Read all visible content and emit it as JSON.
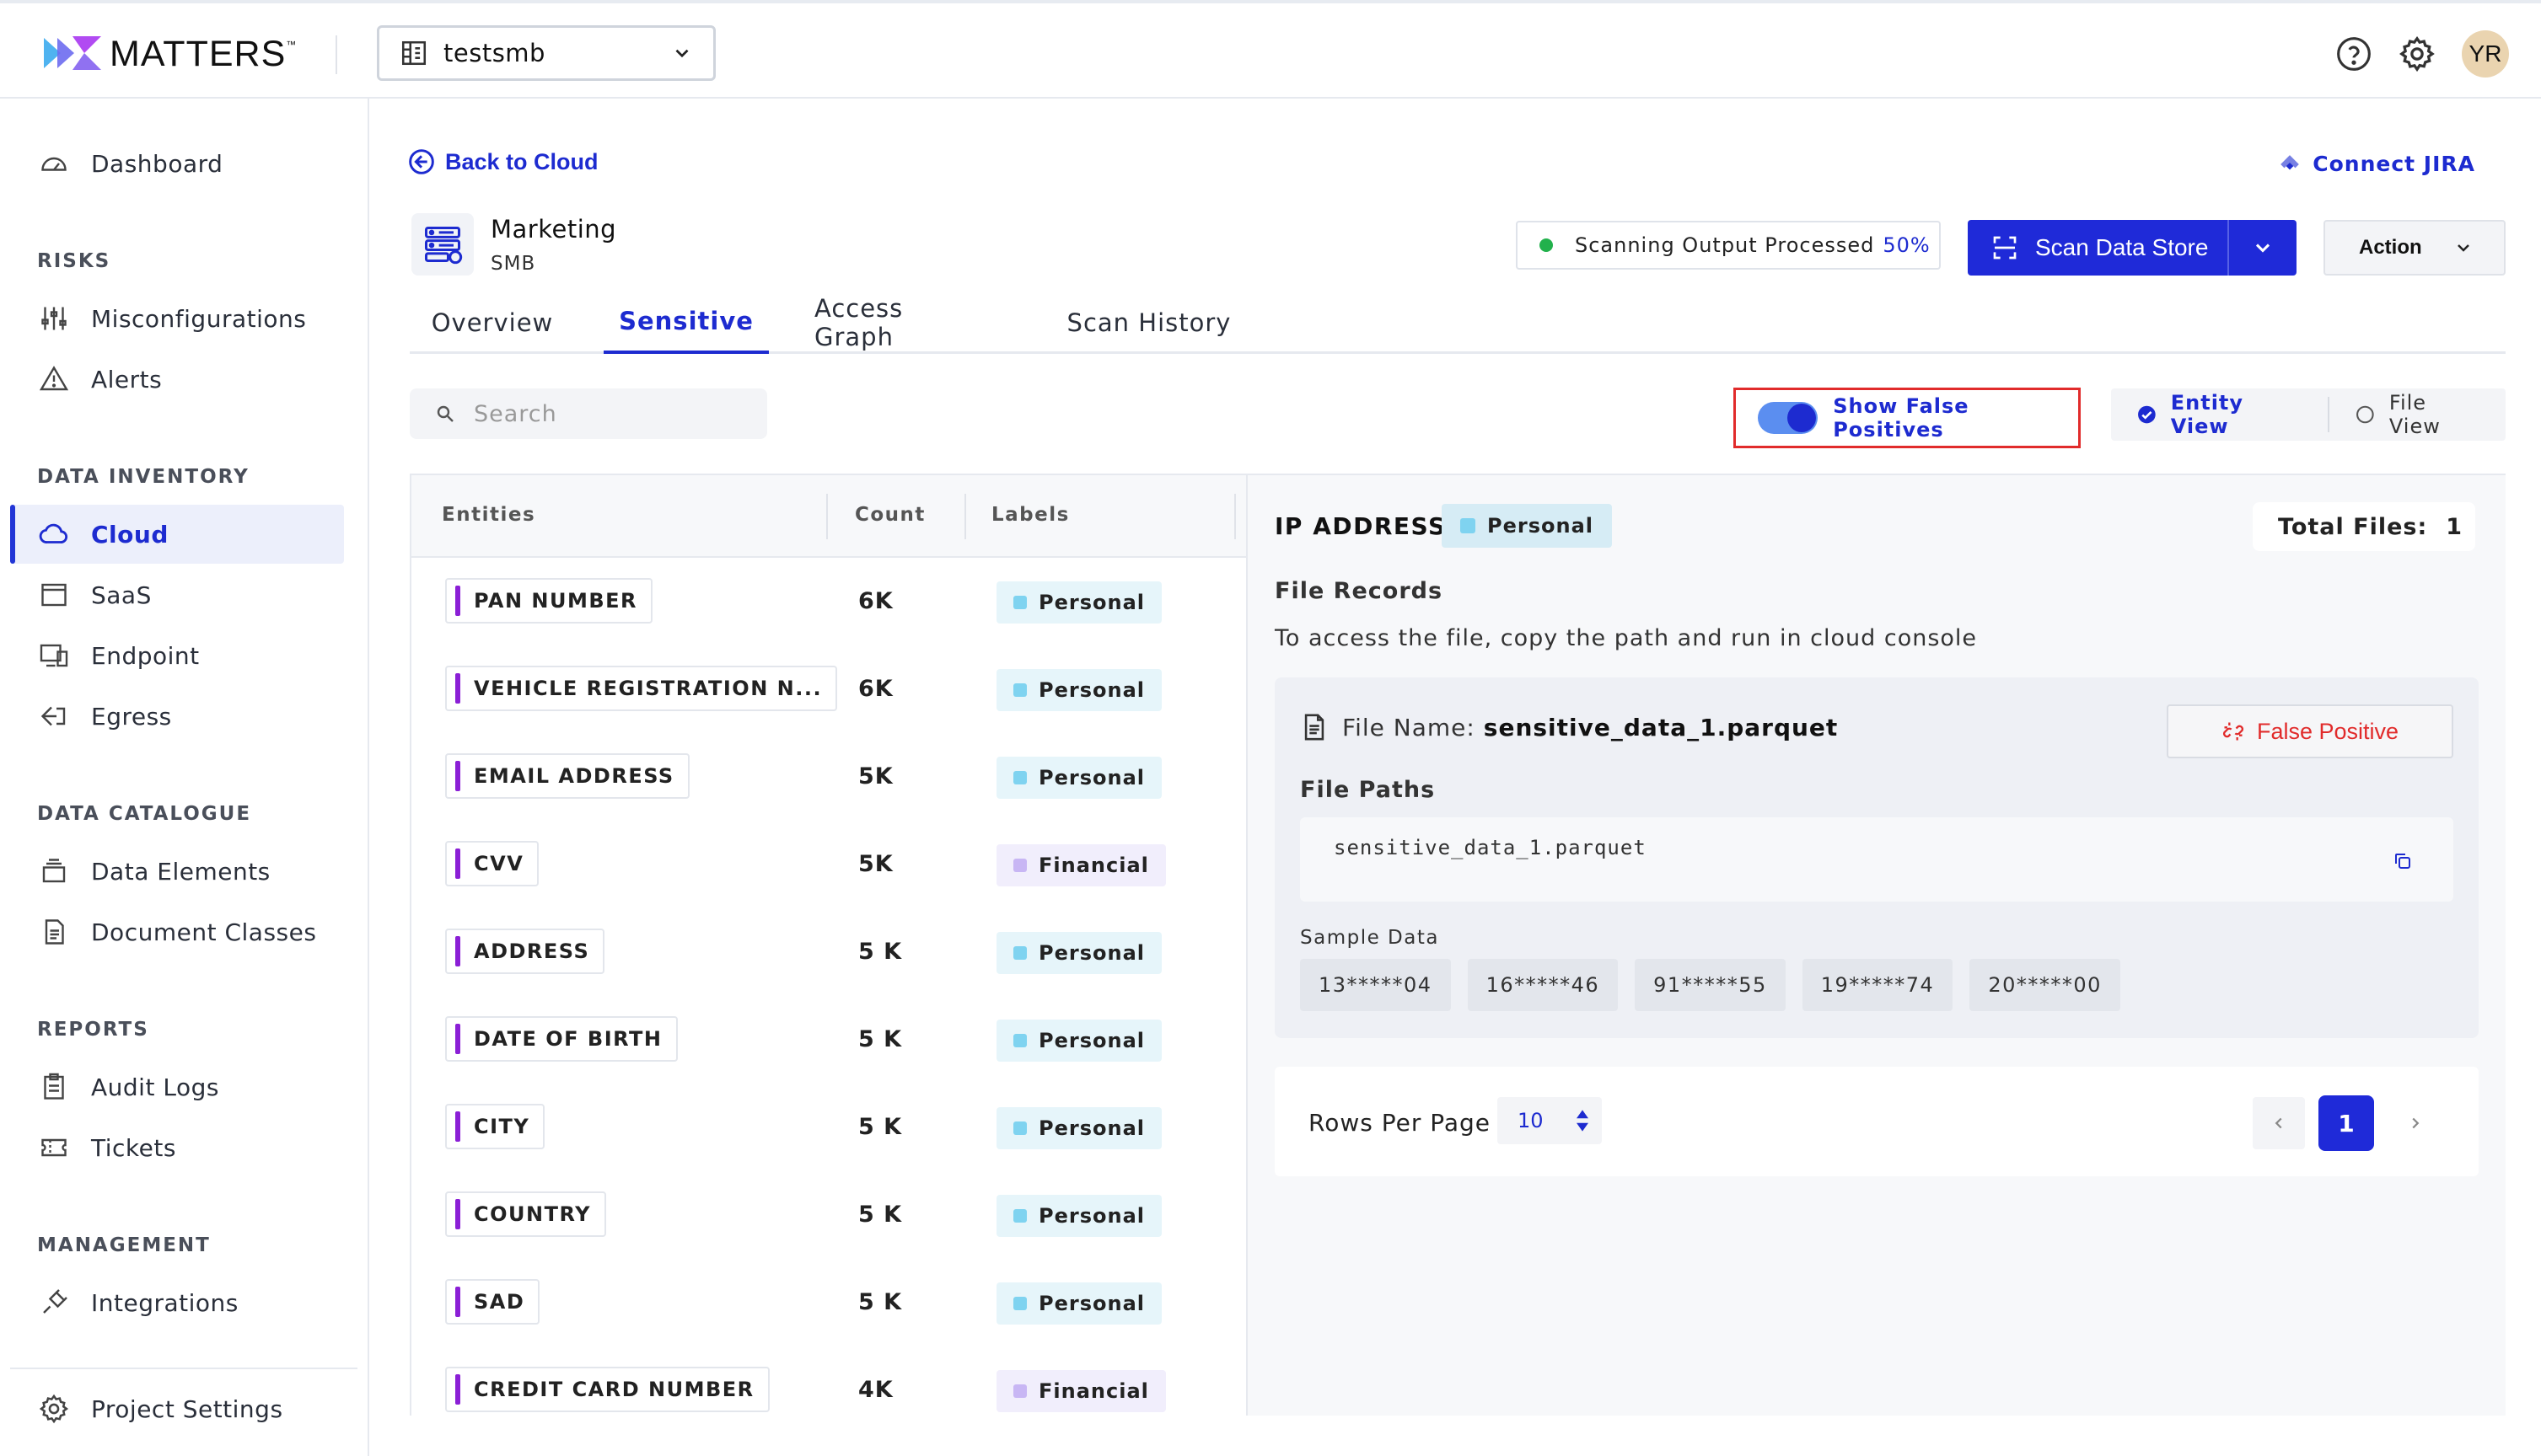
{
  "header": {
    "brand": "MATTERS",
    "brand_tm": "™",
    "workspace": "testsmb",
    "avatar_initials": "YR"
  },
  "icons": {
    "help": "help-circle-icon",
    "settings": "gear-icon",
    "workspace": "building-icon",
    "chevron": "chevron-down-icon"
  },
  "sidebar": {
    "dashboard": "Dashboard",
    "sections": {
      "risks": "RISKS",
      "inventory": "DATA INVENTORY",
      "catalogue": "DATA CATALOGUE",
      "reports": "REPORTS",
      "management": "MANAGEMENT"
    },
    "items": {
      "misconfigurations": "Misconfigurations",
      "alerts": "Alerts",
      "cloud": "Cloud",
      "saas": "SaaS",
      "endpoint": "Endpoint",
      "egress": "Egress",
      "data_elements": "Data Elements",
      "document_classes": "Document Classes",
      "audit_logs": "Audit Logs",
      "tickets": "Tickets",
      "integrations": "Integrations",
      "project_settings": "Project Settings"
    },
    "active": "Cloud"
  },
  "page": {
    "back_label": "Back to Cloud",
    "connect_jira": "Connect JIRA",
    "store_name": "Marketing",
    "store_type": "SMB",
    "scan_status_text": "Scanning Output Processed",
    "scan_status_pct": "50%",
    "scan_button": "Scan Data Store",
    "action_button": "Action"
  },
  "tabs": {
    "overview": "Overview",
    "sensitive": "Sensitive",
    "access_graph": "Access Graph",
    "scan_history": "Scan History",
    "active": "Sensitive"
  },
  "toolbar": {
    "search_placeholder": "Search",
    "show_false_positives": "Show False Positives",
    "show_false_positives_on": true,
    "entity_view": "Entity View",
    "file_view": "File View",
    "selected_view": "Entity View"
  },
  "entities_table": {
    "headers": {
      "entities": "Entities",
      "count": "Count",
      "labels": "Labels"
    },
    "rows": [
      {
        "entity": "PAN NUMBER",
        "count": "6K",
        "label": "Personal"
      },
      {
        "entity": "VEHICLE REGISTRATION N...",
        "count": "6K",
        "label": "Personal"
      },
      {
        "entity": "EMAIL ADDRESS",
        "count": "5K",
        "label": "Personal"
      },
      {
        "entity": "CVV",
        "count": "5K",
        "label": "Financial"
      },
      {
        "entity": "ADDRESS",
        "count": "5 K",
        "label": "Personal"
      },
      {
        "entity": "DATE OF BIRTH",
        "count": "5 K",
        "label": "Personal"
      },
      {
        "entity": "CITY",
        "count": "5 K",
        "label": "Personal"
      },
      {
        "entity": "COUNTRY",
        "count": "5 K",
        "label": "Personal"
      },
      {
        "entity": "SAD",
        "count": "5 K",
        "label": "Personal"
      },
      {
        "entity": "CREDIT CARD NUMBER",
        "count": "4K",
        "label": "Financial"
      }
    ]
  },
  "detail": {
    "entity_title": "IP ADDRESS",
    "entity_label": "Personal",
    "total_files_label": "Total Files:",
    "total_files_value": "1",
    "file_records_title": "File Records",
    "file_records_desc": "To access the file, copy the path and run in cloud console",
    "file_name_label": "File Name:",
    "file_name": "sensitive_data_1.parquet",
    "false_positive_button": "False Positive",
    "file_paths_title": "File Paths",
    "file_path": "sensitive_data_1.parquet",
    "sample_data_title": "Sample Data",
    "sample_data": [
      "13*****04",
      "16*****46",
      "91*****55",
      "19*****74",
      "20*****00"
    ],
    "rows_per_page_label": "Rows Per Page",
    "rows_per_page": "10",
    "current_page": "1"
  },
  "colors": {
    "primary": "#1f2ad8",
    "danger": "#e12b2b",
    "personal_label": "#e6f5fa",
    "financial_label": "#f1eefc",
    "entity_accent": "#8b1fd6"
  }
}
